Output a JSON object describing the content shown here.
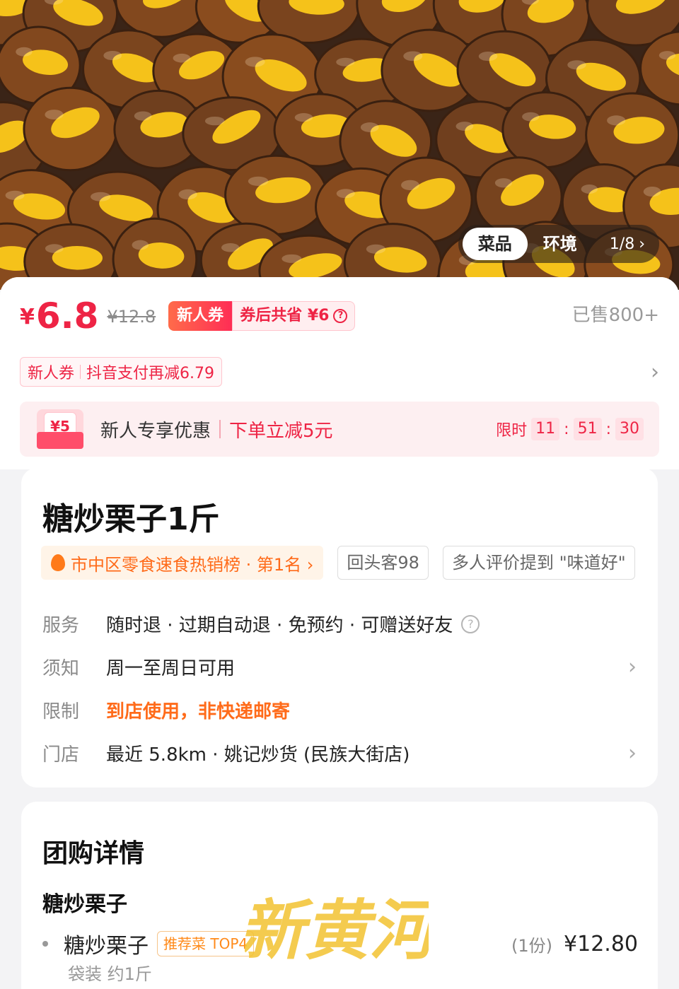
{
  "gallery": {
    "tabs": [
      "菜品",
      "环境"
    ],
    "counter": "1/8"
  },
  "price": {
    "currency": "¥",
    "current": "6.8",
    "original": "¥12.8",
    "coupon_label": "新人券",
    "coupon_savings": "券后共省 ¥6",
    "sold": "已售800+"
  },
  "payment": {
    "chip_label": "新人券",
    "chip_text": "抖音支付再减6.79"
  },
  "promo": {
    "badge_value": "¥5",
    "title": "新人专享优惠",
    "deal": "下单立减5元",
    "timer_label": "限时",
    "hours": "11",
    "minutes": "51",
    "seconds": "30"
  },
  "product": {
    "title": "糖炒栗子1斤",
    "rank_tag": "市中区零食速食热销榜 · 第1名 ›",
    "repeat_tag": "回头客98",
    "review_tag": "多人评价提到 \"味道好\""
  },
  "details": [
    {
      "label": "服务",
      "value": "随时退 · 过期自动退 · 免预约 · 可赠送好友"
    },
    {
      "label": "须知",
      "value": "周一至周日可用"
    },
    {
      "label": "限制",
      "value": "到店使用，非快递邮寄"
    },
    {
      "label": "门店",
      "value": "最近 5.8km · 姚记炒货 (民族大街店)"
    }
  ],
  "group": {
    "title": "团购详情",
    "subtitle": "糖炒栗子",
    "item_name": "糖炒栗子",
    "item_tag": "推荐菜 TOP4",
    "item_qty": "(1份)",
    "item_price": "¥12.80",
    "item_desc": "袋装 约1斤"
  },
  "watermark": "新黄河",
  "colors": {
    "accent": "#ee2445",
    "orange": "#ff6b1a",
    "chestnut": "#7a4523",
    "kernel": "#f5c21a"
  }
}
